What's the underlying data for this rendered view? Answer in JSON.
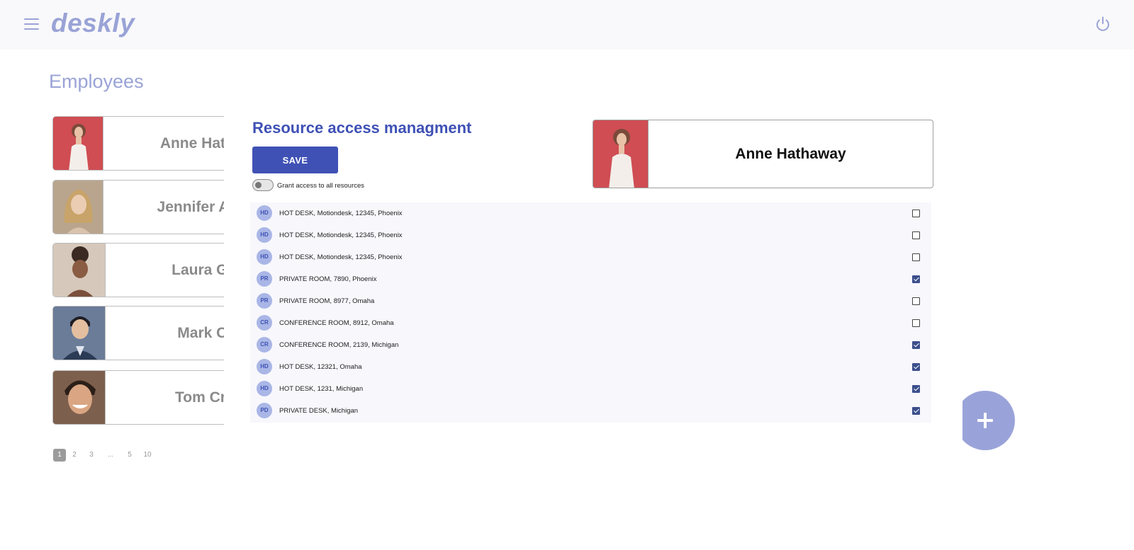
{
  "app": {
    "logo": "deskly"
  },
  "header": {
    "menu_icon": "hamburger-menu-icon",
    "power_icon": "power-icon"
  },
  "page": {
    "title": "Employees"
  },
  "employees": [
    {
      "name": "Anne Hathaway",
      "photo_bg": "#c94148"
    },
    {
      "name": "Jennifer Aniston",
      "photo_bg": "#b9a58e"
    },
    {
      "name": "Laura Green",
      "photo_bg": "#cdbfb2"
    },
    {
      "name": "Mark Clark",
      "photo_bg": "#5b6e8c"
    },
    {
      "name": "Tom Cruise",
      "photo_bg": "#8a6a55"
    }
  ],
  "pagination": {
    "pages": [
      "1",
      "2",
      "3",
      "...",
      "5",
      "10"
    ],
    "active": "1"
  },
  "dialog": {
    "title": "Resource access managment",
    "save_label": "SAVE",
    "grant_all_label": "Grant access to all resources",
    "grant_all_checked": false
  },
  "selected_employee": {
    "name": "Anne Hathaway"
  },
  "resources": [
    {
      "badge": "HD",
      "label": "HOT DESK, Motiondesk, 12345, Phoenix",
      "checked": false
    },
    {
      "badge": "HD",
      "label": "HOT DESK, Motiondesk, 12345, Phoenix",
      "checked": false
    },
    {
      "badge": "HD",
      "label": "HOT DESK, Motiondesk, 12345, Phoenix",
      "checked": false
    },
    {
      "badge": "PR",
      "label": "PRIVATE ROOM, 7890, Phoenix",
      "checked": true
    },
    {
      "badge": "PR",
      "label": "PRIVATE ROOM, 8977, Omaha",
      "checked": false
    },
    {
      "badge": "CR",
      "label": "CONFERENCE ROOM, 8912, Omaha",
      "checked": false
    },
    {
      "badge": "CR",
      "label": "CONFERENCE ROOM, 2139, Michigan",
      "checked": true
    },
    {
      "badge": "HD",
      "label": "HOT DESK, 12321, Omaha",
      "checked": true
    },
    {
      "badge": "HD",
      "label": "HOT DESK, 1231, Michigan",
      "checked": true
    },
    {
      "badge": "PD",
      "label": "PRIVATE DESK, Michigan",
      "checked": true
    }
  ],
  "fab": {
    "icon": "plus-icon"
  },
  "colors": {
    "brand": "#9aa3d6",
    "primary": "#3f51b5",
    "checkbox_checked": "#3c4f8c"
  }
}
